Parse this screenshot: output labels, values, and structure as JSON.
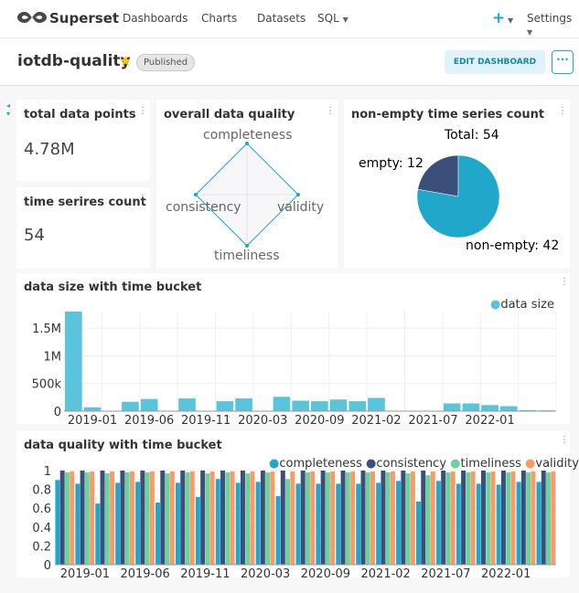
{
  "nav": {
    "brand": "Superset",
    "links": [
      "Dashboards",
      "Charts",
      "Datasets",
      "SQL"
    ],
    "settings": "Settings",
    "plus": "+",
    "colors": {
      "accent": "#20a7c9"
    }
  },
  "dashboard": {
    "title": "iotdb-quality",
    "status": "Published",
    "edit_label": "EDIT DASHBOARD",
    "more": "···"
  },
  "cards": {
    "total_points": {
      "title": "total data points",
      "value": "4.78M"
    },
    "series_count": {
      "title": "time serires count",
      "value": "54"
    },
    "radar": {
      "title": "overall data quality",
      "axes": [
        "completeness",
        "validity",
        "timeliness",
        "consistency"
      ]
    },
    "pie": {
      "title": "non-empty time series count",
      "total_label": "Total: 54",
      "slices": [
        {
          "label": "empty: 12",
          "name": "empty",
          "value": 12,
          "color": "#3c4f7b"
        },
        {
          "label": "non-empty: 42",
          "name": "non-empty",
          "value": 42,
          "color": "#20a7c9"
        }
      ]
    },
    "size": {
      "title": "data size with time bucket",
      "legend": "data size"
    },
    "quality": {
      "title": "data quality with time bucket",
      "legend": [
        "completeness",
        "consistency",
        "timeliness",
        "validity"
      ]
    }
  },
  "chart_data": [
    {
      "type": "radar",
      "title": "overall data quality",
      "axes": [
        "completeness",
        "validity",
        "timeliness",
        "consistency"
      ],
      "values": [
        1,
        1,
        1,
        1
      ],
      "max": 1
    },
    {
      "type": "pie",
      "title": "non-empty time series count",
      "total": 54,
      "slices": [
        {
          "name": "empty",
          "value": 12
        },
        {
          "name": "non-empty",
          "value": 42
        }
      ]
    },
    {
      "type": "bar",
      "title": "data size with time bucket",
      "series_name": "data size",
      "color": "#59c4dc",
      "tick_labels": [
        "2019-01",
        "2019-06",
        "2019-11",
        "2020-03",
        "2020-09",
        "2021-02",
        "2021-07",
        "2022-01"
      ],
      "yticks": [
        "0",
        "500k",
        "1M",
        "1.5M"
      ],
      "ylim": [
        0,
        1800000
      ],
      "values": [
        1800000,
        70000,
        0,
        170000,
        220000,
        0,
        230000,
        0,
        180000,
        230000,
        0,
        260000,
        190000,
        180000,
        210000,
        180000,
        240000,
        0,
        0,
        0,
        140000,
        140000,
        110000,
        90000,
        20000,
        15000
      ]
    },
    {
      "type": "bar",
      "title": "data quality with time bucket",
      "categories_count": 25,
      "tick_labels": [
        "2019-01",
        "2019-06",
        "2019-11",
        "2020-03",
        "2020-09",
        "2021-02",
        "2021-07",
        "2022-01"
      ],
      "yticks": [
        "0",
        "0.2",
        "0.4",
        "0.6",
        "0.8",
        "1"
      ],
      "ylim": [
        0,
        1
      ],
      "series": [
        {
          "name": "completeness",
          "color": "#20a7c9",
          "values": [
            0.9,
            0.86,
            0.65,
            0.87,
            0.88,
            0.66,
            0.87,
            0.72,
            0.91,
            0.87,
            0.88,
            0.73,
            0.86,
            0.86,
            0.86,
            0.86,
            0.87,
            0.89,
            0.67,
            0.89,
            0.86,
            0.86,
            0.85,
            0.88,
            0.88
          ]
        },
        {
          "name": "consistency",
          "color": "#3c4f7b",
          "values": [
            1,
            1,
            1,
            1,
            1,
            1,
            1,
            1,
            1,
            1,
            1,
            1,
            1,
            1,
            1,
            1,
            1,
            1,
            1,
            1,
            1,
            1,
            1,
            1,
            1
          ]
        },
        {
          "name": "timeliness",
          "color": "#6dd39c",
          "values": [
            0.98,
            0.98,
            0.97,
            0.98,
            0.98,
            0.97,
            0.98,
            0.97,
            0.98,
            0.97,
            0.98,
            0.91,
            0.98,
            0.98,
            0.98,
            0.98,
            0.98,
            0.97,
            0.95,
            0.98,
            0.98,
            0.98,
            0.98,
            0.98,
            0.98
          ]
        },
        {
          "name": "validity",
          "color": "#fa9a69",
          "values": [
            0.99,
            0.99,
            0.99,
            0.99,
            0.99,
            0.99,
            0.99,
            0.99,
            0.99,
            0.99,
            0.99,
            0.99,
            0.99,
            0.99,
            0.99,
            0.99,
            0.99,
            0.99,
            0.99,
            0.99,
            0.99,
            0.99,
            0.99,
            0.99,
            0.99
          ]
        }
      ]
    }
  ]
}
